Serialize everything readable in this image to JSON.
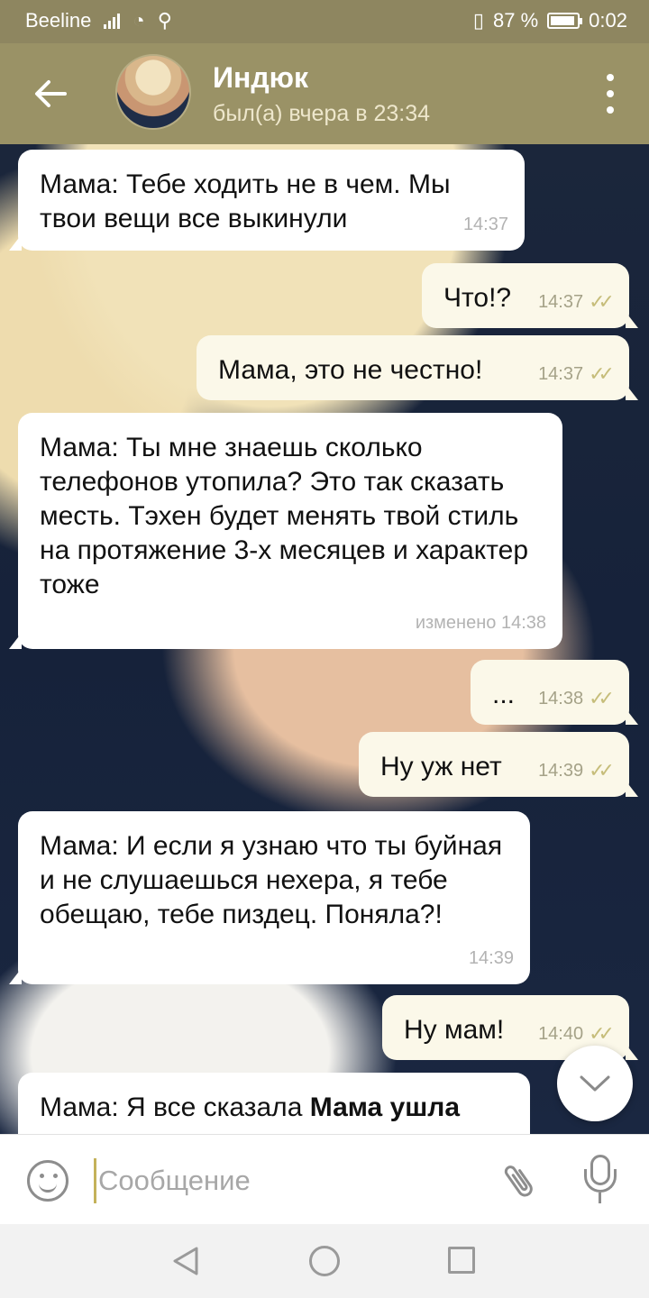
{
  "status_bar": {
    "carrier": "Beeline",
    "battery_percent": "87 %",
    "time": "0:02"
  },
  "header": {
    "back_icon": "arrow-left-icon",
    "contact_name": "Индюк",
    "last_seen": "был(а) вчера в 23:34",
    "menu_icon": "more-vertical-icon"
  },
  "messages": [
    {
      "direction": "in",
      "text": "Мама: Тебе ходить не в чем. Мы твои вещи все выкинули",
      "time": "14:37"
    },
    {
      "direction": "out",
      "text": "Что!?",
      "time": "14:37",
      "read": true
    },
    {
      "direction": "out",
      "text": "Мама, это не честно!",
      "time": "14:37",
      "read": true
    },
    {
      "direction": "in",
      "text": "Мама: Ты мне знаешь сколько телефонов утопила? Это так сказать месть. Тэхен будет менять твой стиль на протяжение 3-х месяцев и характер тоже",
      "time": "изменено 14:38"
    },
    {
      "direction": "out",
      "text": "...",
      "time": "14:38",
      "read": true
    },
    {
      "direction": "out",
      "text": "Ну уж нет",
      "time": "14:39",
      "read": true
    },
    {
      "direction": "in",
      "text": "Мама: И если я узнаю что ты буйная и не слушаешься нехера, я тебе обещаю, тебе пиздец. Поняла?!",
      "time": "14:39"
    },
    {
      "direction": "out",
      "text": "Ну мам!",
      "time": "14:40",
      "read": true
    },
    {
      "direction": "in",
      "text_prefix": "Мама: Я все сказала ",
      "text_bold": "Мама ушла"
    }
  ],
  "input": {
    "placeholder": "Сообщение",
    "value": ""
  },
  "colors": {
    "header": "#9a9266",
    "status_bar": "#8e8660",
    "outgoing_bubble": "#fbf8e9",
    "incoming_bubble": "#ffffff",
    "read_ticks": "#c6bd7a"
  }
}
